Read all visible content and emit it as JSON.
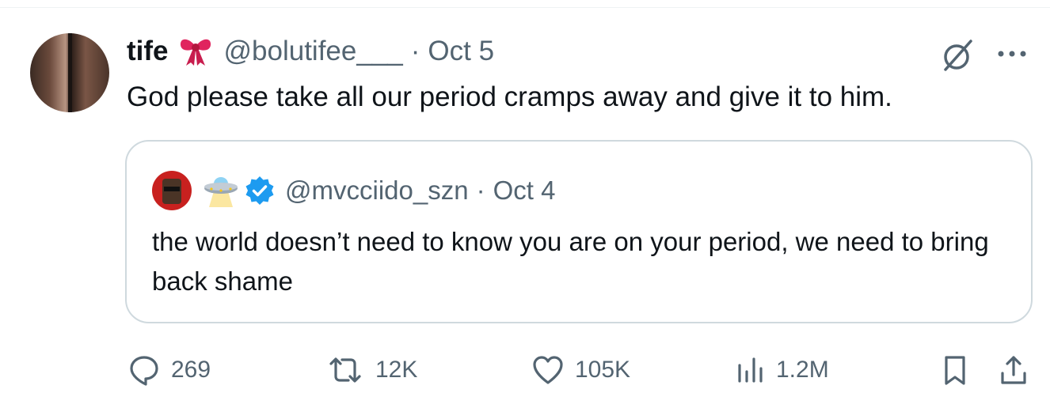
{
  "tweet": {
    "author": {
      "display_name": "tife",
      "handle": "@bolutifee___",
      "name_emoji_icon": "ribbon-icon"
    },
    "separator": "·",
    "date": "Oct 5",
    "text": "God please take all our period cramps away and give it to him.",
    "header_icons": [
      "grok-icon",
      "more-icon"
    ]
  },
  "quoted_tweet": {
    "author": {
      "handle": "@mvcciido_szn",
      "name_emoji_icon": "ufo-icon",
      "verified": true
    },
    "separator": "·",
    "date": "Oct 4",
    "text": "the world doesn’t need to know you are on your period, we need to bring back shame"
  },
  "actions": {
    "replies": "269",
    "retweets": "12K",
    "likes": "105K",
    "views": "1.2M",
    "icons": [
      "reply-icon",
      "retweet-icon",
      "like-icon",
      "views-icon",
      "bookmark-icon",
      "share-icon"
    ]
  },
  "colors": {
    "text_primary": "#0f1419",
    "text_secondary": "#536471",
    "border": "#cfd9de",
    "verified_blue": "#1d9bf0",
    "ribbon_red": "#e0245e"
  }
}
